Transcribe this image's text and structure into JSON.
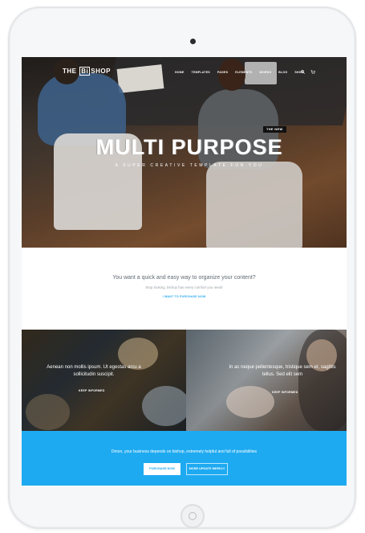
{
  "nav": {
    "logo_prefix": "THE",
    "logo_box": "Bi",
    "logo_suffix": "SHOP",
    "items": [
      "HOME",
      "TEMPLATES",
      "PAGES",
      "ELEMENTS",
      "WORKS",
      "BLOG",
      "SHOP"
    ],
    "icons": [
      "search-icon",
      "cart-icon"
    ]
  },
  "hero": {
    "badge": "THE NEW",
    "title": "MULTI PURPOSE",
    "subtitle": "A SUPER CREATIVE TEMPLATE FOR YOU"
  },
  "intro": {
    "question": "You want a quick and easy way to organize your content?",
    "subtext": "Stop looking, bishop has every comfort you need!",
    "link": "I WANT TO PURCHASE NOW"
  },
  "tiles": [
    {
      "text": "Aenean non mollis ipsum. Ut egestas arcu a sollicitudin suscipit.",
      "button": "KEEP INFORMED"
    },
    {
      "text": "In ac neque pellentesque, tristique sem et, sagittis tellus. Sed elit sem",
      "button": "KEEP INFORMED"
    }
  ],
  "cta": {
    "text": "Dmon, your business depends on bishop, extremely helpful and full of possibilities",
    "primary_button": "PURCHASE NOW",
    "secondary_button": "MORE UPDATE WEEKLY"
  },
  "colors": {
    "accent": "#1eaaf1",
    "badge_bg": "#111111",
    "text_muted": "#5f6a73"
  }
}
